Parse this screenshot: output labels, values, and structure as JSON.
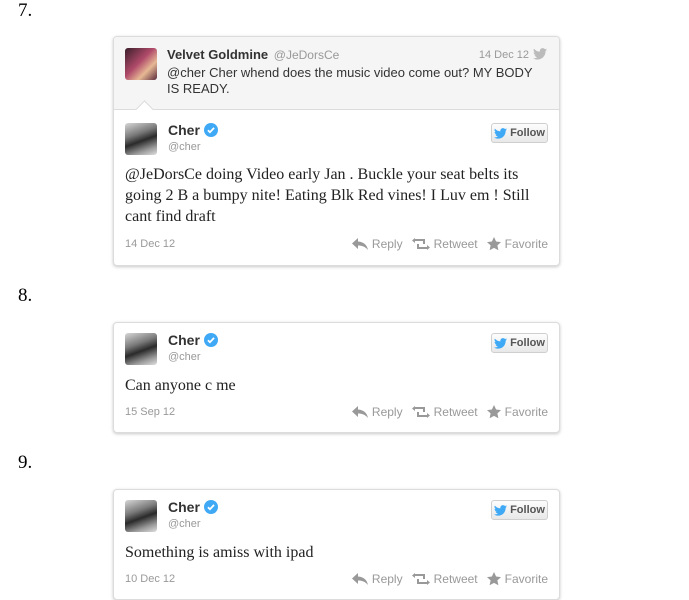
{
  "items": [
    {
      "number": "7.",
      "reply_to": {
        "name": "Velvet Goldmine",
        "handle": "@JeDorsCe",
        "date": "14 Dec 12",
        "text": "@cher Cher whend does the music video come out? MY BODY IS READY."
      },
      "tweet": {
        "name": "Cher",
        "handle": "@cher",
        "follow_label": "Follow",
        "text": "@JeDorsCe doing Video early Jan . Buckle your seat belts its going 2 B a bumpy nite! Eating Blk Red vines! I Luv em ! Still cant find draft",
        "date": "14 Dec 12"
      }
    },
    {
      "number": "8.",
      "tweet": {
        "name": "Cher",
        "handle": "@cher",
        "follow_label": "Follow",
        "text": "Can anyone c me",
        "date": "15 Sep 12"
      }
    },
    {
      "number": "9.",
      "tweet": {
        "name": "Cher",
        "handle": "@cher",
        "follow_label": "Follow",
        "text": "Something is amiss with ipad",
        "date": "10 Dec 12"
      }
    }
  ],
  "actions": {
    "reply": "Reply",
    "retweet": "Retweet",
    "favorite": "Favorite"
  },
  "colors": {
    "verified": "#3fa9f5",
    "muted": "#999999",
    "border": "#dcdcdc"
  }
}
